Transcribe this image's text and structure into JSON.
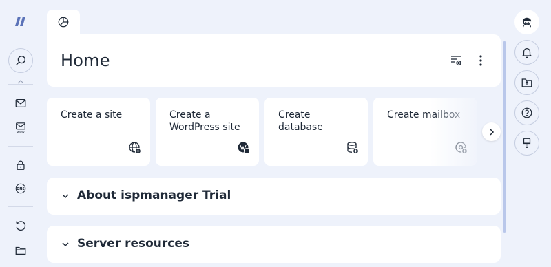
{
  "tabs": [
    {
      "icon": "dashboard-pie-icon"
    }
  ],
  "header": {
    "title": "Home"
  },
  "quick_actions": [
    {
      "label": "Create a site",
      "icon": "globe-add-icon"
    },
    {
      "label": "Create a WordPress site",
      "icon": "wordpress-add-icon"
    },
    {
      "label": "Create database",
      "icon": "database-add-icon"
    },
    {
      "label": "Create mailbox",
      "icon": "mailbox-add-icon"
    }
  ],
  "sections": [
    {
      "title": "About ispmanager Trial",
      "expanded": false
    },
    {
      "title": "Server resources",
      "expanded": false
    }
  ],
  "left_nav": [
    "search-icon",
    "mail-icon",
    "www-mail-icon",
    "lock-icon",
    "dns-icon",
    "history-icon",
    "folder-icon"
  ],
  "right_nav": [
    "user-avatar-icon",
    "bell-icon",
    "upload-folder-icon",
    "help-icon",
    "brush-icon"
  ],
  "dns_icon_text": "DNS",
  "www_icon_text": "www",
  "colors": {
    "background": "#eef2fb",
    "card": "#ffffff",
    "text": "#1f2937",
    "accent": "#5b73b8"
  }
}
